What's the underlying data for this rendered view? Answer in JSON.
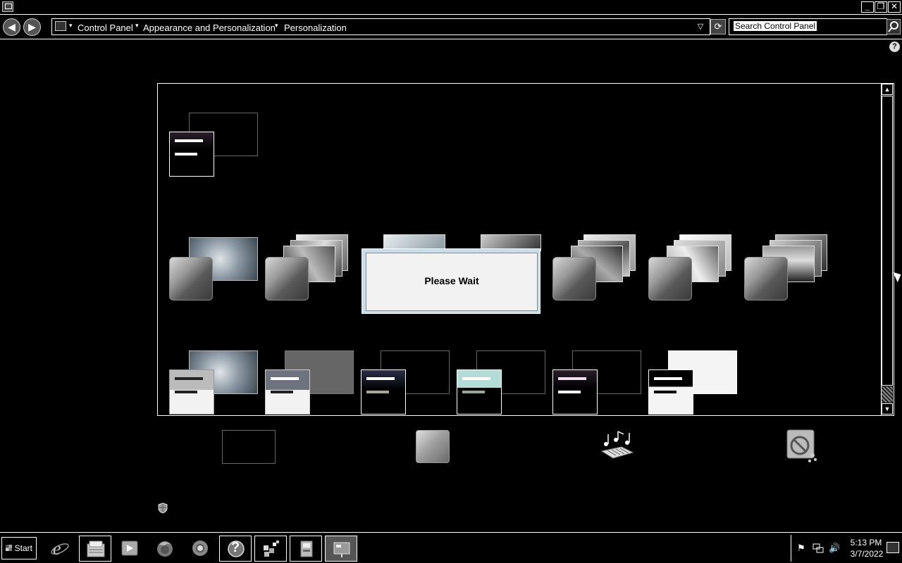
{
  "window": {
    "minimize_glyph": "_",
    "restore_glyph": "❐",
    "close_glyph": "✕"
  },
  "nav": {
    "back_glyph": "◀",
    "forward_glyph": "▶",
    "dropdown_glyph": "▽",
    "refresh_glyph": "⟳"
  },
  "breadcrumbs": [
    {
      "label": "Control Panel"
    },
    {
      "label": "Appearance and Personalization"
    },
    {
      "label": "Personalization"
    }
  ],
  "search": {
    "value": "Search Control Panel"
  },
  "help": {
    "glyph": "?"
  },
  "dialog": {
    "message": "Please Wait"
  },
  "scrollbar": {
    "up_glyph": "▲",
    "down_glyph": "▼"
  },
  "taskbar": {
    "start_label": "Start",
    "items": [
      {
        "icon": "internet-explorer-icon"
      },
      {
        "icon": "file-manager-icon"
      },
      {
        "icon": "media-player-icon"
      },
      {
        "icon": "firefox-icon"
      },
      {
        "icon": "chrome-icon"
      },
      {
        "icon": "help-icon",
        "glyph": "?"
      },
      {
        "icon": "network-app-icon"
      },
      {
        "icon": "control-panel-icon"
      },
      {
        "icon": "personalization-icon"
      }
    ],
    "tray": {
      "time": "5:13 PM",
      "date": "3/7/2022",
      "flag_glyph": "⚑",
      "volume_glyph": "🔊"
    }
  },
  "colors": {
    "background": "#000000",
    "foreground": "#ffffff",
    "dialog_border": "#c8dcec",
    "dialog_fill": "#f2f2f2"
  }
}
